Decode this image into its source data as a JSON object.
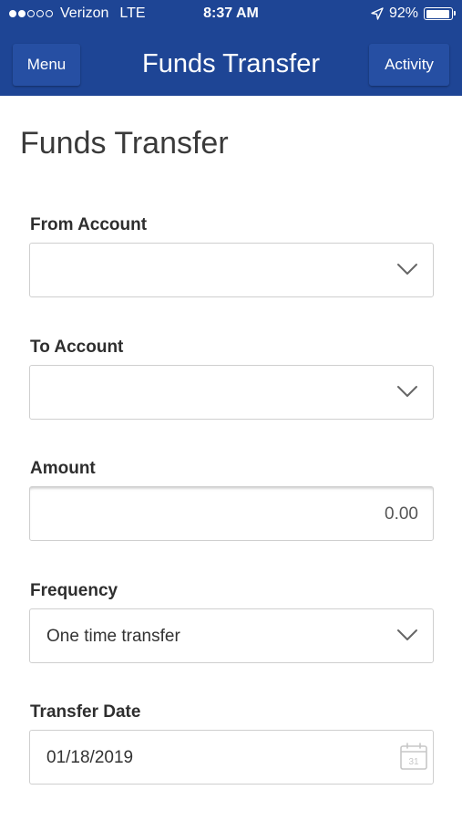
{
  "status_bar": {
    "carrier": "Verizon",
    "network": "LTE",
    "time": "8:37 AM",
    "battery": "92%",
    "signal_bars": 2,
    "signal_total": 5
  },
  "nav": {
    "menu_label": "Menu",
    "title": "Funds Transfer",
    "activity_label": "Activity"
  },
  "page": {
    "title": "Funds Transfer"
  },
  "form": {
    "from_account": {
      "label": "From Account",
      "value": ""
    },
    "to_account": {
      "label": "To Account",
      "value": ""
    },
    "amount": {
      "label": "Amount",
      "placeholder": "0.00"
    },
    "frequency": {
      "label": "Frequency",
      "value": "One time transfer"
    },
    "transfer_date": {
      "label": "Transfer Date",
      "value": "01/18/2019",
      "calendar_day": "31"
    }
  },
  "colors": {
    "header_bg": "#1e4595",
    "nav_button_bg": "#264fa3",
    "field_border": "#cfcfcf"
  },
  "icons": {
    "dropdown": "chevron-down-icon",
    "calendar": "calendar-icon",
    "location": "location-arrow-icon",
    "battery": "battery-icon"
  }
}
